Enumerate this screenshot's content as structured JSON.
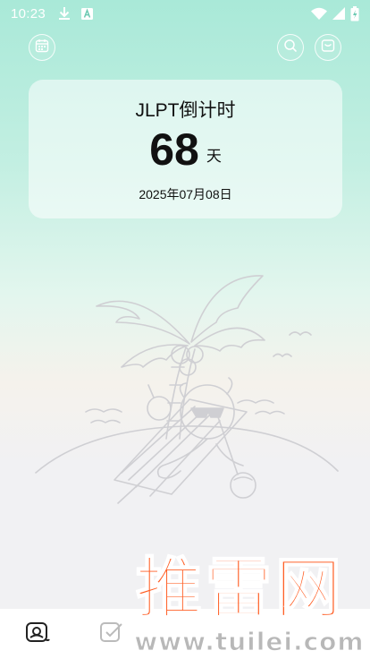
{
  "status_bar": {
    "time": "10:23",
    "left_icons": [
      "download-icon",
      "keyboard-a-icon"
    ],
    "right_icons": [
      "wifi-icon",
      "signal-icon",
      "battery-icon"
    ]
  },
  "header": {
    "left_icon": "calendar-icon",
    "right_icons": [
      "search-icon",
      "mail-icon"
    ]
  },
  "countdown": {
    "title": "JLPT倒计时",
    "days": "68",
    "unit": "天",
    "date": "2025年07月08日"
  },
  "illustration": {
    "name": "beach-palm-tree-character-illustration"
  },
  "bottom_nav": {
    "items": [
      {
        "icon": "home-scene-icon",
        "active": true
      },
      {
        "icon": "checkbox-icon",
        "active": false
      }
    ]
  },
  "watermark": {
    "cn_text": "推雷网",
    "url_text": "www.tuilei.com"
  },
  "colors": {
    "gradient_top": "#a9e9d8",
    "gradient_bottom": "#f1f1f3",
    "watermark_orange": "#ff5a1f",
    "line_art": "#cfcfd3"
  }
}
